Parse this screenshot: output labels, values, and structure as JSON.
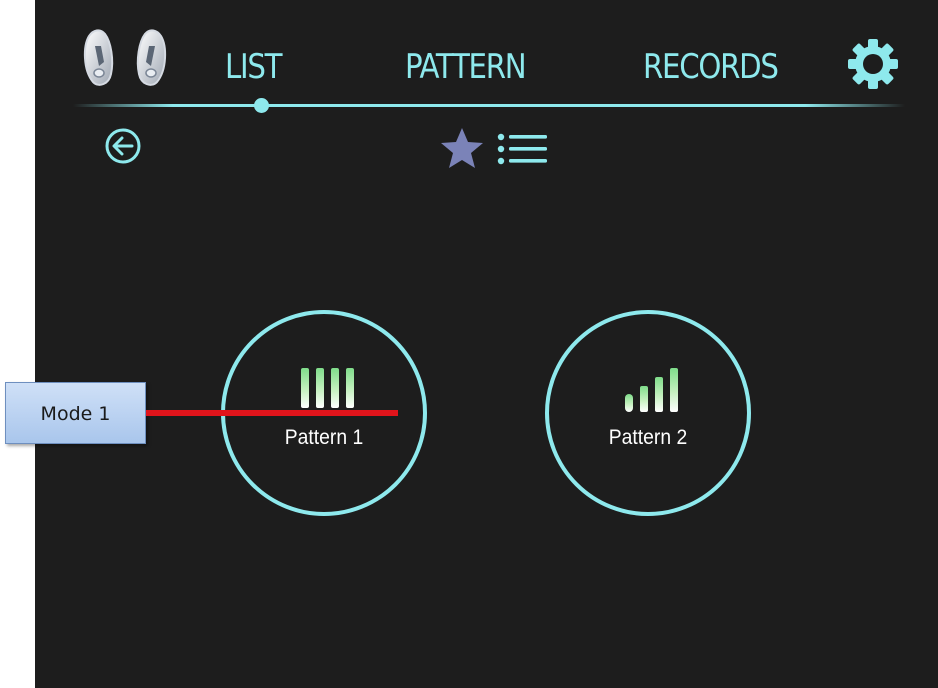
{
  "header": {
    "tabs": [
      {
        "label": "LIST",
        "active": true
      },
      {
        "label": "PATTERN",
        "active": false
      },
      {
        "label": "RECORDS",
        "active": false
      }
    ],
    "icons": {
      "device": "earbuds-icon",
      "settings": "gear-icon",
      "back": "back-arrow-icon",
      "favorites": "star-icon",
      "list": "list-icon"
    }
  },
  "patterns": [
    {
      "label": "Pattern 1",
      "icon": "uniform-bars-icon"
    },
    {
      "label": "Pattern 2",
      "icon": "ascending-bars-icon"
    }
  ],
  "annotation": {
    "label": "Mode 1",
    "line_color": "#e0141b"
  },
  "colors": {
    "background": "#1d1d1d",
    "accent": "#8ee9ed",
    "star": "#7b83b8",
    "bars": "#b6eeb0",
    "text": "#ffffff"
  }
}
